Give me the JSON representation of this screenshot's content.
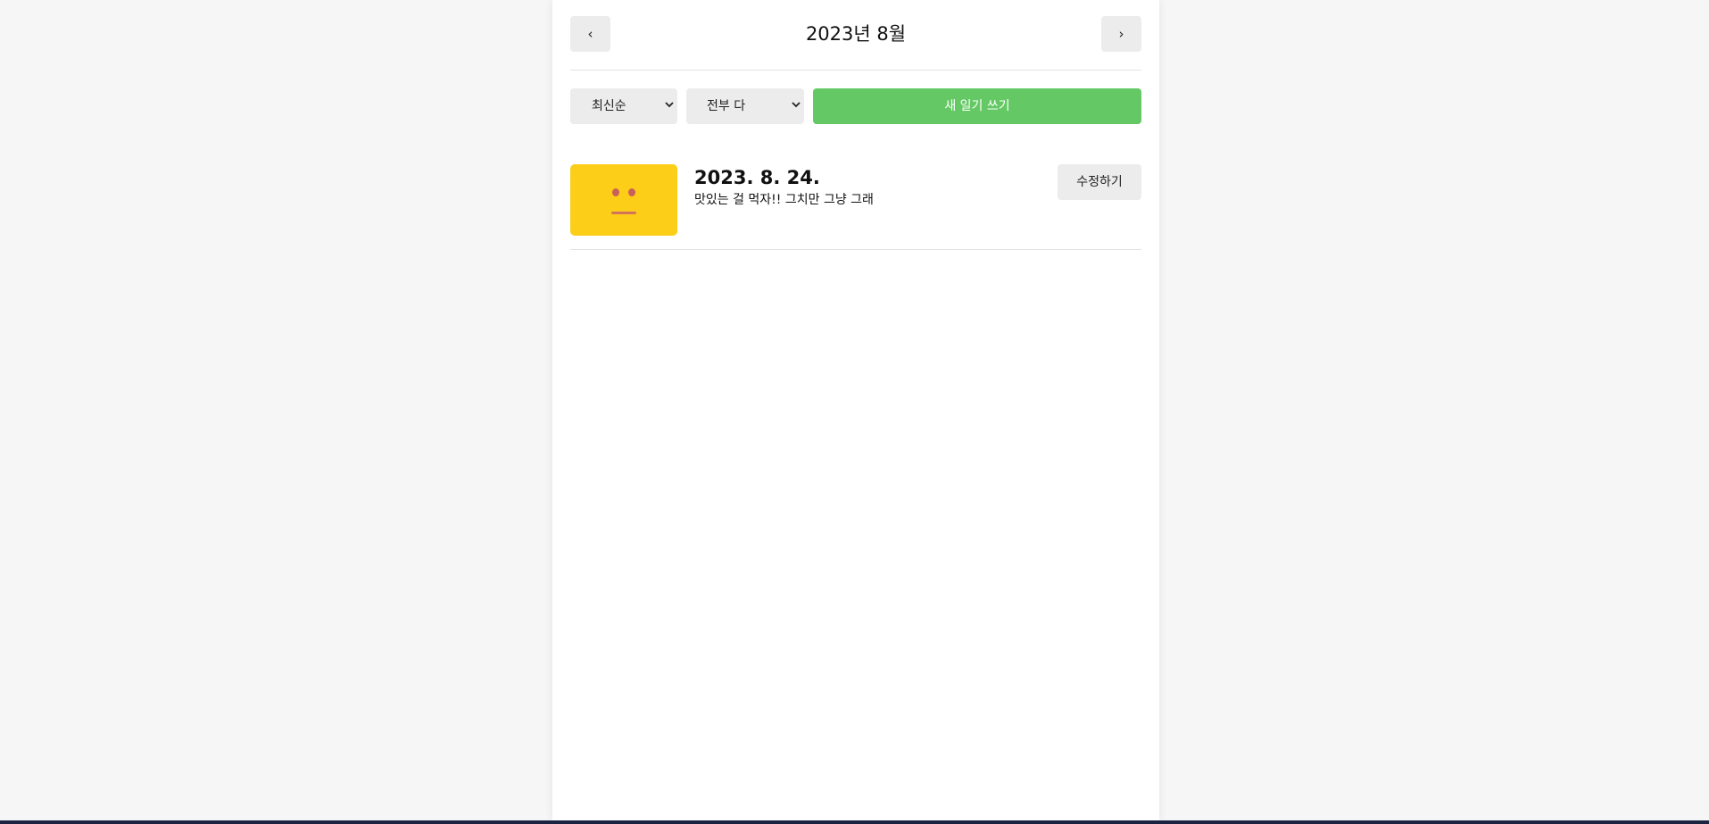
{
  "header": {
    "prev_label": "‹",
    "title": "2023년 8월",
    "next_label": "›"
  },
  "menu": {
    "sort_selected": "최신순",
    "filter_selected": "전부 다",
    "new_button_label": "새 일기 쓰기"
  },
  "diary_list": [
    {
      "date": "2023. 8. 24.",
      "content": "맛있는 걸 먹자!! 그치만 그냥 그래",
      "edit_label": "수정하기",
      "emotion": {
        "icon": "neutral-face-icon",
        "color": "#fdce17"
      }
    }
  ],
  "colors": {
    "accent_green": "#64c964",
    "emotion_yellow": "#fdce17",
    "button_gray": "#ececec"
  }
}
